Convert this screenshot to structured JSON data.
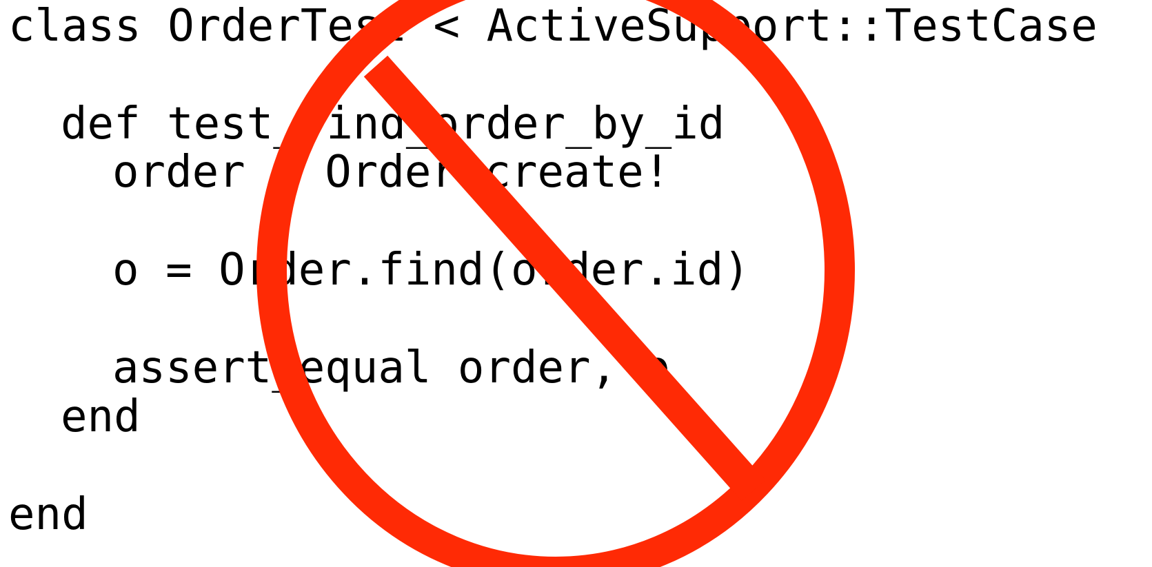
{
  "code": {
    "lines": [
      "class OrderTest < ActiveSupport::TestCase",
      "def test_find_order_by_id",
      "order = Order.create!",
      "o = Order.find(order.id)",
      "assert_equal order, o",
      "end",
      "end"
    ]
  },
  "overlay": {
    "icon": "prohibition-sign-icon",
    "color": "#ff2a05"
  }
}
